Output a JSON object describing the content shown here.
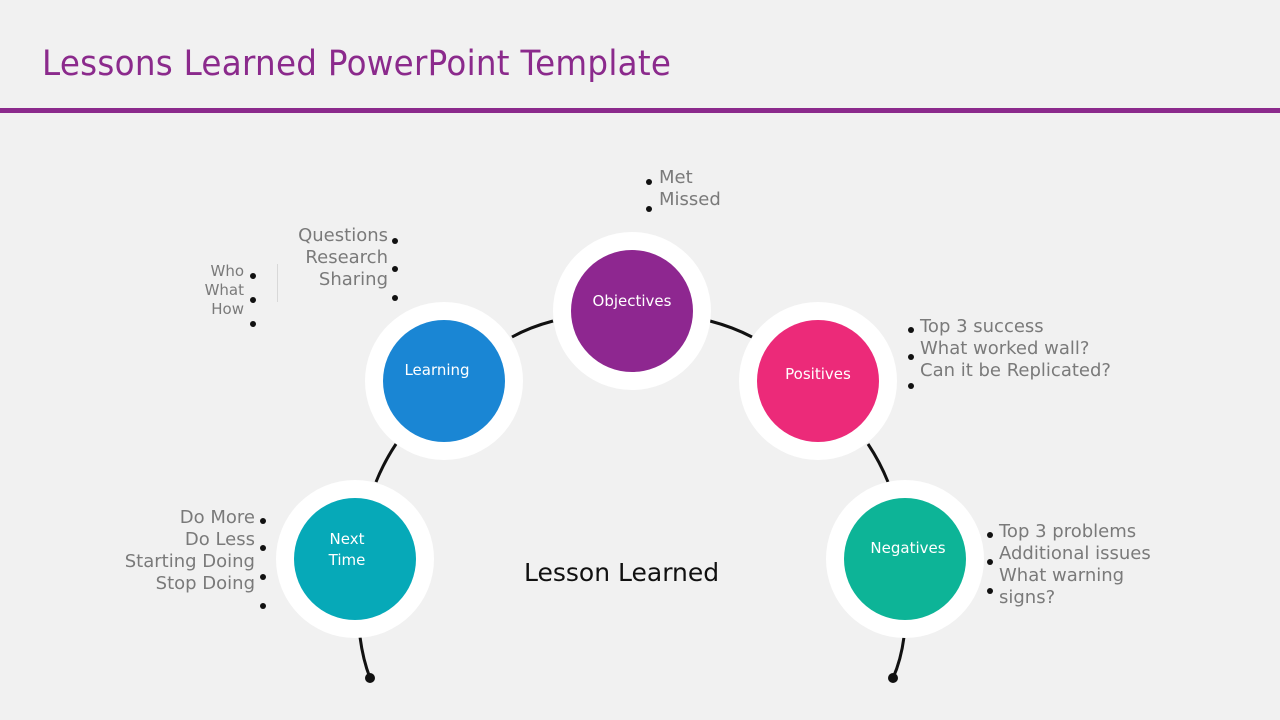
{
  "title": "Lessons Learned PowerPoint Template",
  "center_label": "Lesson Learned",
  "colors": {
    "title": "#8b2a8c",
    "objectives": "#8e2790",
    "learning": "#1a86d4",
    "positives": "#ec2a79",
    "negatives": "#0db497",
    "next_time": "#06a9b8"
  },
  "nodes": {
    "objectives": {
      "label": "Objectives",
      "items": [
        "Met",
        "Missed"
      ]
    },
    "learning": {
      "label": "Learning",
      "items": [
        "Questions",
        "Research",
        "Sharing"
      ],
      "sub_items": [
        "Who",
        "What",
        "How"
      ]
    },
    "positives": {
      "label": "Positives",
      "items": [
        "Top 3 success",
        "What worked wall?",
        "Can it be Replicated?"
      ]
    },
    "negatives": {
      "label": "Negatives",
      "items": [
        "Top 3 problems",
        "Additional issues",
        "What warning",
        "signs?"
      ]
    },
    "next_time": {
      "label_line1": "Next",
      "label_line2": "Time",
      "items": [
        "Do More",
        "Do Less",
        "Starting Doing",
        "Stop Doing"
      ]
    }
  }
}
